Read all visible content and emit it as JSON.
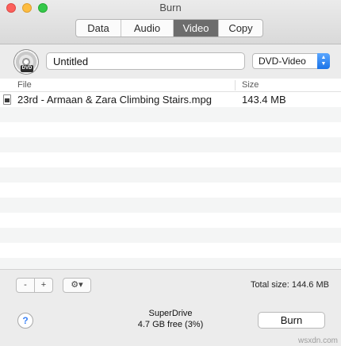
{
  "window": {
    "title": "Burn"
  },
  "tabs": [
    {
      "label": "Data",
      "active": false
    },
    {
      "label": "Audio",
      "active": false
    },
    {
      "label": "Video",
      "active": true
    },
    {
      "label": "Copy",
      "active": false
    }
  ],
  "disc": {
    "icon": "dvd-disc-icon",
    "badge": "DVD"
  },
  "name_field": {
    "value": "Untitled"
  },
  "format_select": {
    "value": "DVD-Video"
  },
  "list": {
    "columns": {
      "file": "File",
      "size": "Size"
    },
    "rows": [
      {
        "icon": "video-file-icon",
        "name": "23rd - Armaan & Zara Climbing Stairs.mpg",
        "size": "143.4 MB"
      }
    ]
  },
  "bottom": {
    "minus_label": "-",
    "plus_label": "+",
    "gear_label": "⚙▾",
    "total_size": "Total size: 144.6 MB",
    "help_label": "?",
    "drive_name": "SuperDrive",
    "drive_free": "4.7 GB free (3%)",
    "burn_label": "Burn"
  },
  "watermark": "wsxdn.com",
  "colors": {
    "active_tab": "#6d6d6d",
    "select_accent": "#1a73e8",
    "close": "#fc605c",
    "minimize": "#fdbc40",
    "maximize": "#34c84a"
  }
}
